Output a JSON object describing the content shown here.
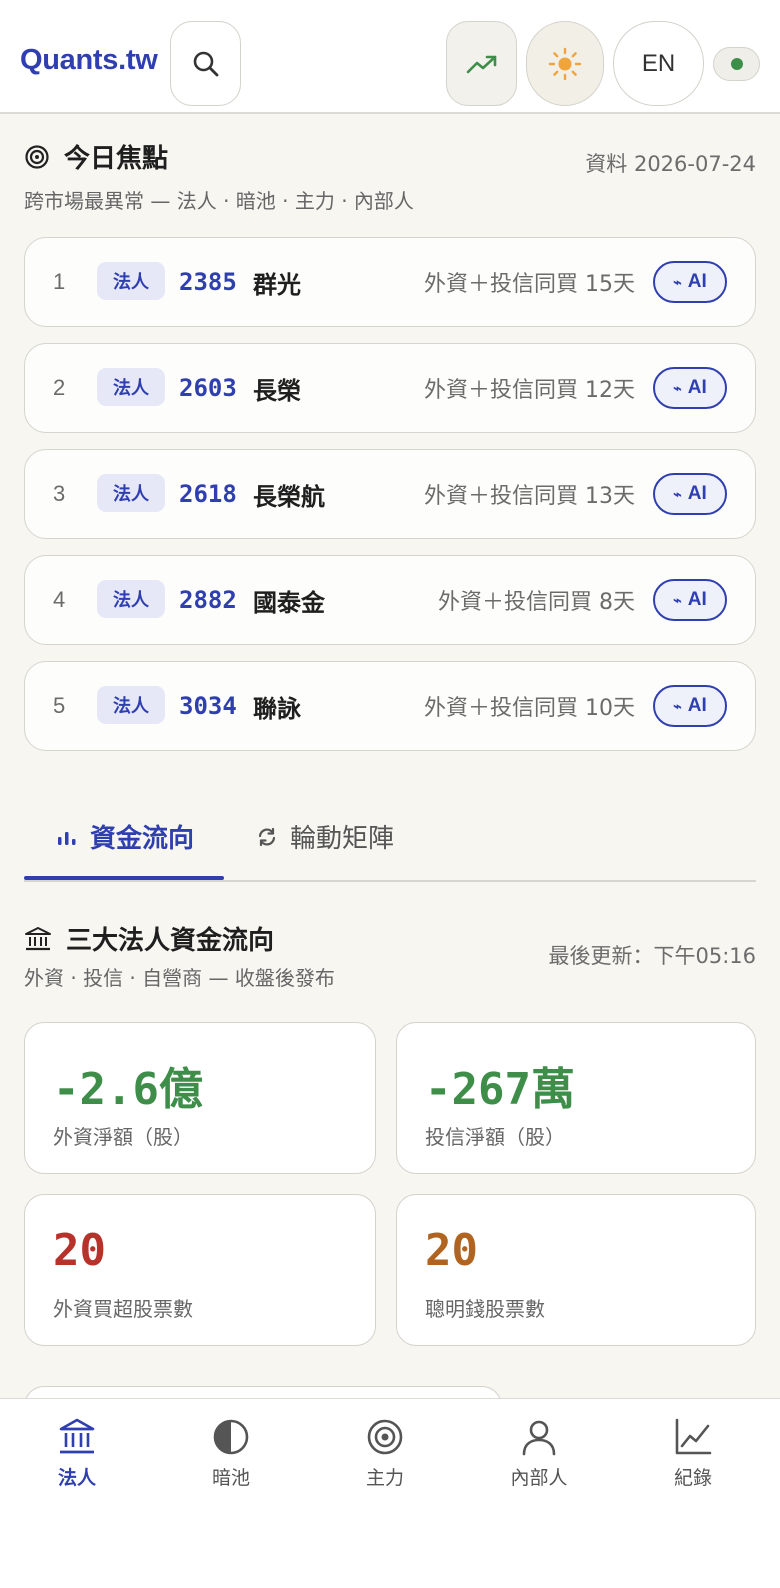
{
  "header": {
    "logo": "Quants.tw",
    "lang_label": "EN",
    "icons": [
      "search-icon",
      "trending-up-icon",
      "sun-icon",
      "status-dot-icon"
    ]
  },
  "focus": {
    "title": "今日焦點",
    "subtitle": "跨市場最異常 — 法人 · 暗池 · 主力 · 內部人",
    "date": "資料 2026-07-24",
    "ai_label": "AI",
    "rows": [
      {
        "rank": "1",
        "tag": "法人",
        "code": "2385",
        "name": "群光",
        "note": "外資＋投信同買 15天"
      },
      {
        "rank": "2",
        "tag": "法人",
        "code": "2603",
        "name": "長榮",
        "note": "外資＋投信同買 12天"
      },
      {
        "rank": "3",
        "tag": "法人",
        "code": "2618",
        "name": "長榮航",
        "note": "外資＋投信同買 13天"
      },
      {
        "rank": "4",
        "tag": "法人",
        "code": "2882",
        "name": "國泰金",
        "note": "外資＋投信同買 8天"
      },
      {
        "rank": "5",
        "tag": "法人",
        "code": "3034",
        "name": "聯詠",
        "note": "外資＋投信同買 10天"
      }
    ]
  },
  "tabs": [
    {
      "label": "資金流向",
      "active": true
    },
    {
      "label": "輪動矩陣",
      "active": false
    }
  ],
  "flow": {
    "title": "三大法人資金流向",
    "subtitle": "外資 · 投信 · 自營商 — 收盤後發布",
    "updated": "最後更新：下午05:16",
    "cards": [
      {
        "value": "-2.6億",
        "label": "外資淨額（股）",
        "color": "#3e8e4a"
      },
      {
        "value": "-267萬",
        "label": "投信淨額（股）",
        "color": "#3e8e4a"
      },
      {
        "value": "20",
        "label": "外資買超股票數",
        "color": "#b8322c"
      },
      {
        "value": "20",
        "label": "聰明錢股票數",
        "color": "#b0641f"
      }
    ]
  },
  "nav": [
    {
      "label": "法人",
      "icon": "bank-icon",
      "active": true
    },
    {
      "label": "暗池",
      "icon": "half-circle-icon",
      "active": false
    },
    {
      "label": "主力",
      "icon": "target-icon",
      "active": false
    },
    {
      "label": "內部人",
      "icon": "person-icon",
      "active": false
    },
    {
      "label": "紀錄",
      "icon": "chart-line-icon",
      "active": false
    }
  ],
  "colors": {
    "accent": "#2f3fb0",
    "up_green": "#3e8e4a",
    "red": "#b8322c",
    "orange": "#b0641f",
    "sun": "#f0a43a"
  }
}
